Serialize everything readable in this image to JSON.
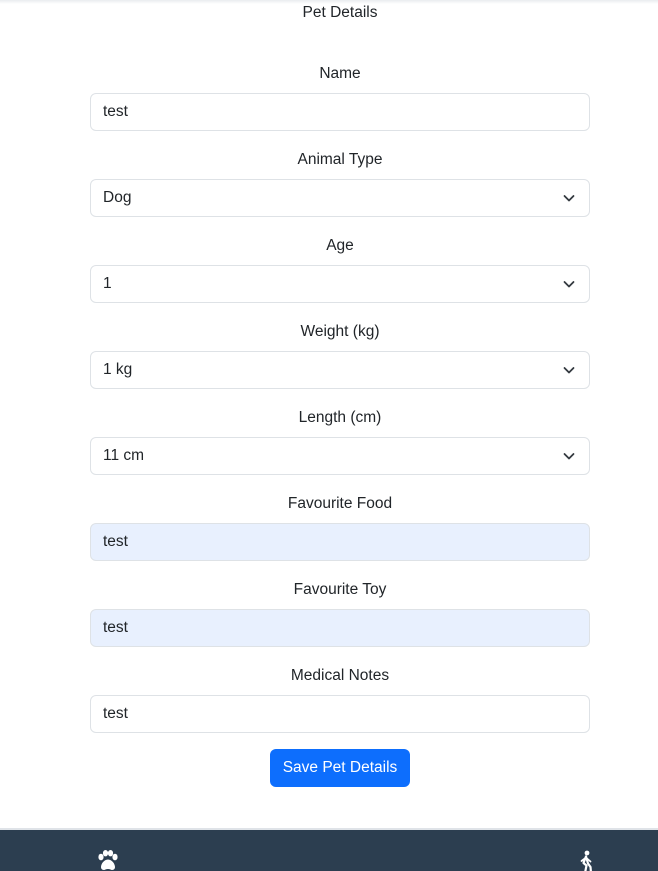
{
  "header": {
    "title": "Pet Details"
  },
  "form": {
    "fields": [
      {
        "label": "Name",
        "value": "test",
        "type": "input"
      },
      {
        "label": "Animal Type",
        "value": "Dog",
        "type": "select"
      },
      {
        "label": "Age",
        "value": "1",
        "type": "select"
      },
      {
        "label": "Weight (kg)",
        "value": "1 kg",
        "type": "select"
      },
      {
        "label": "Length (cm)",
        "value": "11 cm",
        "type": "select"
      },
      {
        "label": "Favourite Food",
        "value": "test",
        "type": "input",
        "autofill": true
      },
      {
        "label": "Favourite Toy",
        "value": "test",
        "type": "input",
        "autofill": true
      },
      {
        "label": "Medical Notes",
        "value": "test",
        "type": "input"
      }
    ],
    "save_label": "Save Pet Details"
  },
  "bottom_nav": {
    "items": [
      {
        "icon": "paw-icon"
      },
      {
        "icon": "walking-icon"
      }
    ]
  },
  "colors": {
    "primary": "#0d6efd",
    "nav_background": "#2c3e50",
    "autofill_background": "#e8f0fe"
  }
}
